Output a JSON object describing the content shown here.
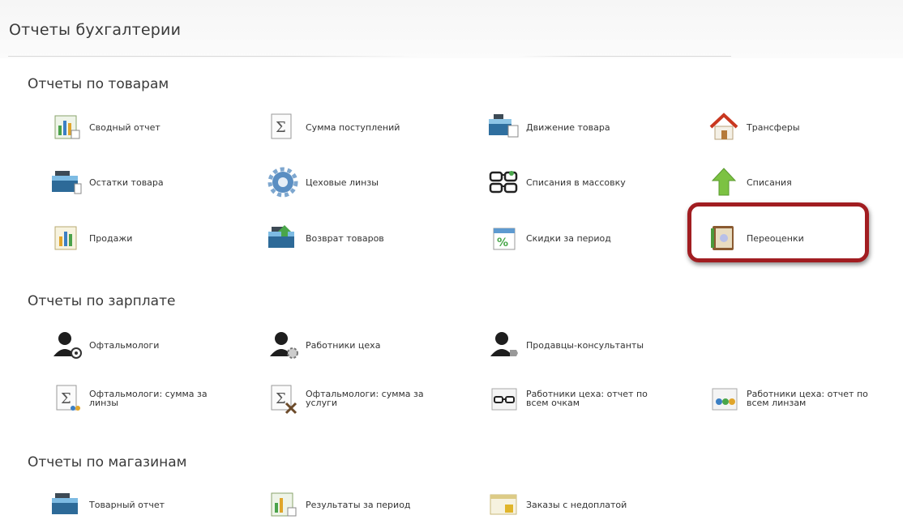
{
  "page": {
    "title": "Отчеты бухгалтерии"
  },
  "sections": {
    "goods": {
      "title": "Отчеты по товарам",
      "items": [
        {
          "label": "Сводный отчет",
          "icon": "summary-report-icon"
        },
        {
          "label": "Сумма поступлений",
          "icon": "sigma-icon"
        },
        {
          "label": "Движение товара",
          "icon": "goods-movement-icon"
        },
        {
          "label": "Трансферы",
          "icon": "house-icon"
        },
        {
          "label": "Остатки товара",
          "icon": "stock-box-icon"
        },
        {
          "label": "Цеховые линзы",
          "icon": "gear-icon"
        },
        {
          "label": "Списания в массовку",
          "icon": "glasses-icon"
        },
        {
          "label": "Списания",
          "icon": "up-arrow-icon"
        },
        {
          "label": "Продажи",
          "icon": "sales-chart-icon"
        },
        {
          "label": "Возврат товаров",
          "icon": "goods-return-icon"
        },
        {
          "label": "Скидки за период",
          "icon": "discount-calendar-icon"
        },
        {
          "label": "Переоценки",
          "icon": "revaluation-book-icon"
        }
      ]
    },
    "salary": {
      "title": "Отчеты по зарплате",
      "items": [
        {
          "label": "Офтальмологи",
          "icon": "user-eye-icon"
        },
        {
          "label": "Работники цеха",
          "icon": "user-gear-icon"
        },
        {
          "label": "Продавцы-консультанты",
          "icon": "user-tag-icon"
        },
        {
          "label": "Офтальмологи: сумма за линзы",
          "icon": "sigma-lenses-icon"
        },
        {
          "label": "Офтальмологи: сумма за услуги",
          "icon": "sigma-tools-icon"
        },
        {
          "label": "Работники цеха: отчет по всем очкам",
          "icon": "glasses-box-icon"
        },
        {
          "label": "Работники цеха: отчет по всем линзам",
          "icon": "lenses-box-icon"
        }
      ]
    },
    "stores": {
      "title": "Отчеты по магазинам",
      "items": [
        {
          "label": "Товарный отчет",
          "icon": "stock-box-icon"
        },
        {
          "label": "Результаты за период",
          "icon": "period-results-icon"
        },
        {
          "label": "Заказы с недоплатой",
          "icon": "underpaid-orders-icon"
        }
      ]
    }
  },
  "colors": {
    "highlight": "#a11d21",
    "text": "#333333",
    "heading": "#3a3a3a"
  }
}
